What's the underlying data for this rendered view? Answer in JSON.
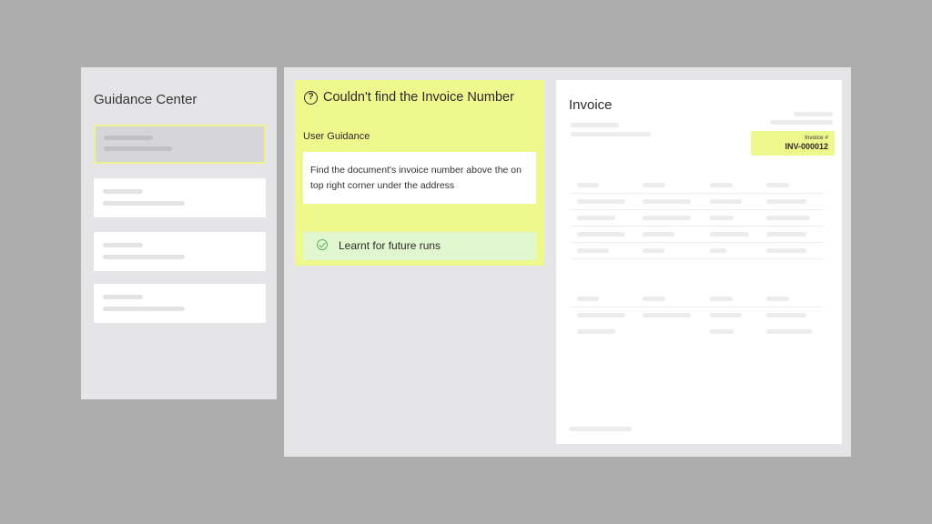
{
  "sidebar": {
    "title": "Guidance Center",
    "items": [
      {
        "state": "selected"
      },
      {
        "state": "normal"
      },
      {
        "state": "normal"
      },
      {
        "state": "normal"
      }
    ]
  },
  "guidance": {
    "title": "Couldn't find the Invoice Number",
    "section_label": "User Guidance",
    "text": "Find the document's invoice number above the on top right corner under the address",
    "learnt_label": "Learnt for future runs",
    "icon": "question-circle-icon",
    "status_icon": "check-circle-icon"
  },
  "invoice": {
    "title": "Invoice",
    "badge_label": "Invoice #",
    "badge_number": "INV-000012"
  },
  "colors": {
    "highlight": "#eff88c",
    "success_bg": "#e1f7cf",
    "success_icon": "#64b35e",
    "background": "#adadad",
    "panel": "#e5e5e7"
  }
}
